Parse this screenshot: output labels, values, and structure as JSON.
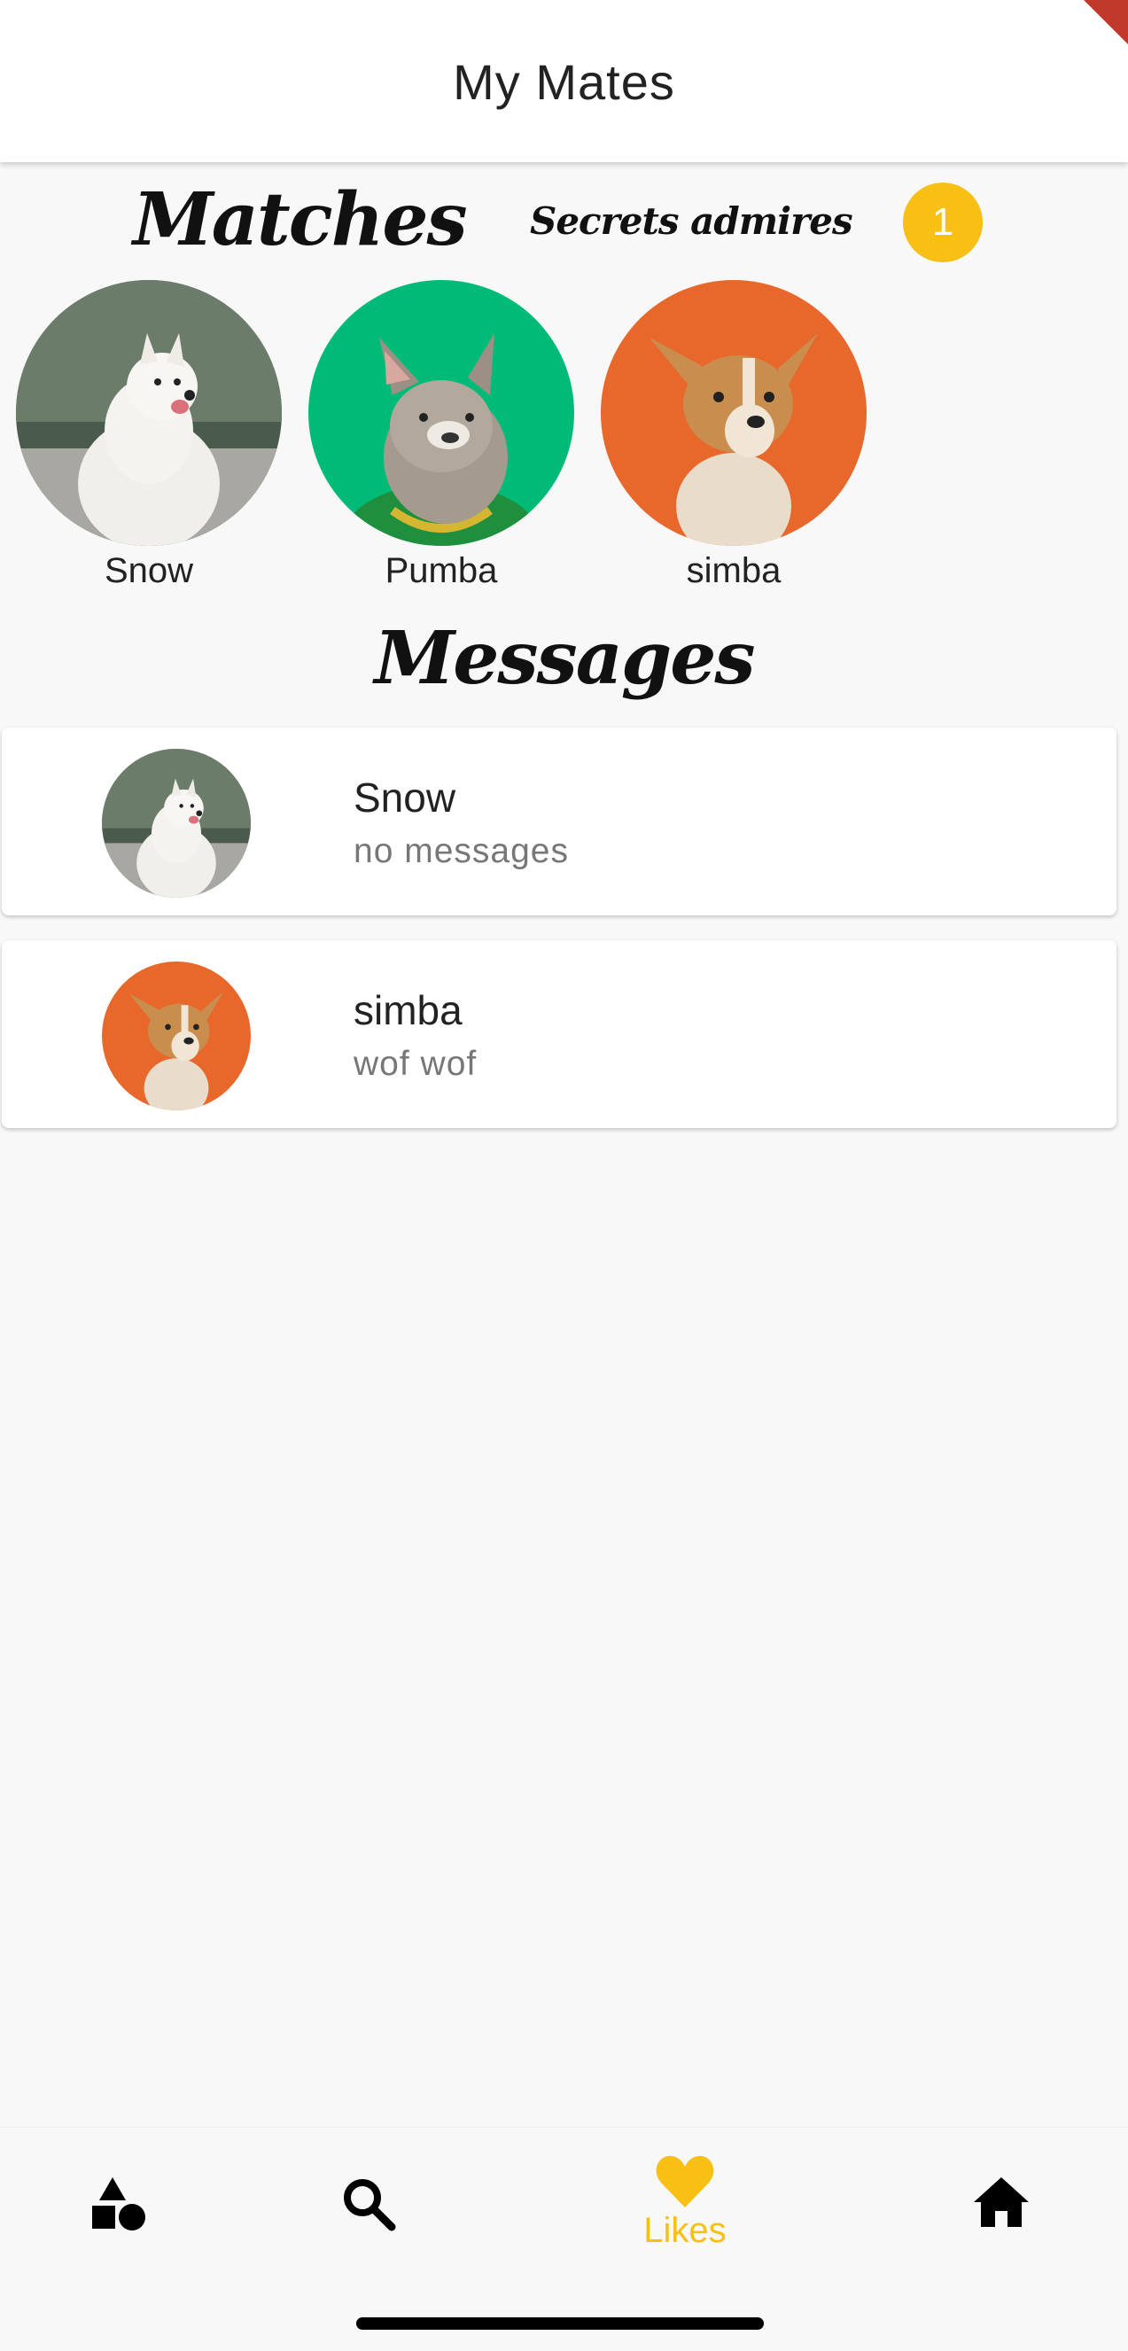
{
  "app_bar": {
    "title": "My Mates"
  },
  "matches_section": {
    "title": "Matches",
    "secrets_label": "Secrets admires",
    "secrets_count": "1",
    "items": [
      {
        "name": "Snow"
      },
      {
        "name": "Pumba"
      },
      {
        "name": "simba"
      }
    ]
  },
  "messages_section": {
    "title": "Messages",
    "items": [
      {
        "name": "Snow",
        "message": "no messages"
      },
      {
        "name": "simba",
        "message": "wof wof"
      }
    ]
  },
  "bottom_nav": {
    "items": [
      {
        "icon": "shapes-icon",
        "label": ""
      },
      {
        "icon": "search-icon",
        "label": ""
      },
      {
        "icon": "heart-icon",
        "label": "Likes",
        "active": true
      },
      {
        "icon": "home-icon",
        "label": ""
      }
    ]
  },
  "colors": {
    "accent": "#f8bf14",
    "pumba_bg": "#00bb77",
    "simba_bg": "#e8672a"
  }
}
